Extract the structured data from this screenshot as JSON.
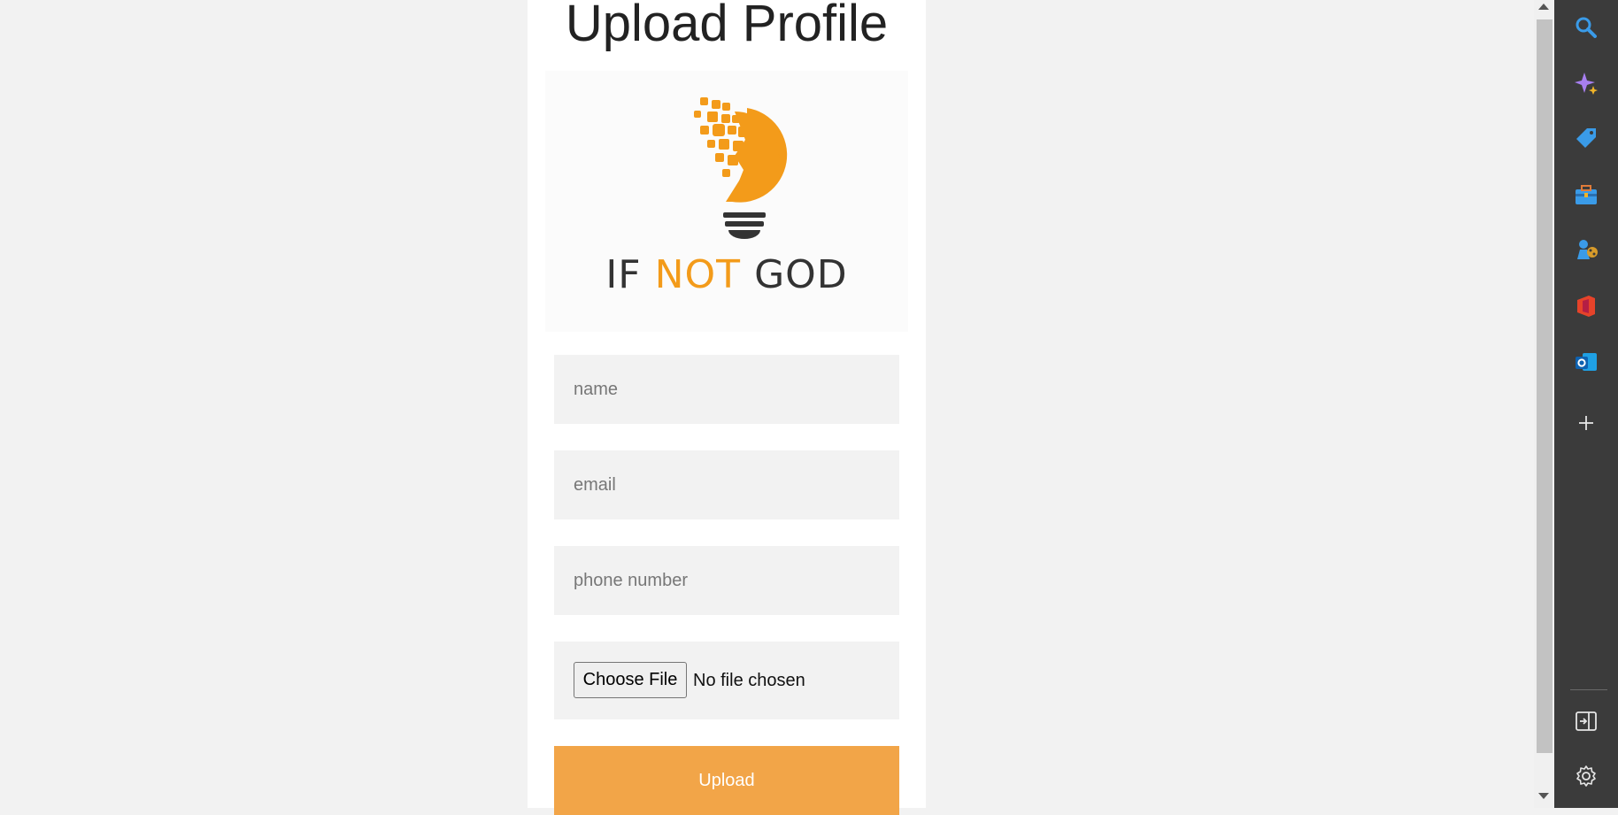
{
  "page": {
    "title": "Upload Profile"
  },
  "logo": {
    "text_part1": "IF",
    "text_part2": "NOT",
    "text_part3": "GOD",
    "accent_color": "#f39b1a",
    "dark_color": "#333333"
  },
  "form": {
    "name_placeholder": "name",
    "email_placeholder": "email",
    "phone_placeholder": "phone number",
    "file_button_label": "Choose File",
    "file_status": "No file chosen",
    "submit_label": "Upload",
    "submit_color": "#f2a548"
  },
  "sidebar": {
    "items": [
      {
        "icon": "search-icon"
      },
      {
        "icon": "copilot-sparkle-icon"
      },
      {
        "icon": "shopping-tag-icon"
      },
      {
        "icon": "tools-briefcase-icon"
      },
      {
        "icon": "games-icon"
      },
      {
        "icon": "office-icon"
      },
      {
        "icon": "outlook-icon"
      },
      {
        "icon": "add-icon"
      },
      {
        "icon": "hide-sidebar-icon"
      },
      {
        "icon": "settings-gear-icon"
      }
    ]
  }
}
